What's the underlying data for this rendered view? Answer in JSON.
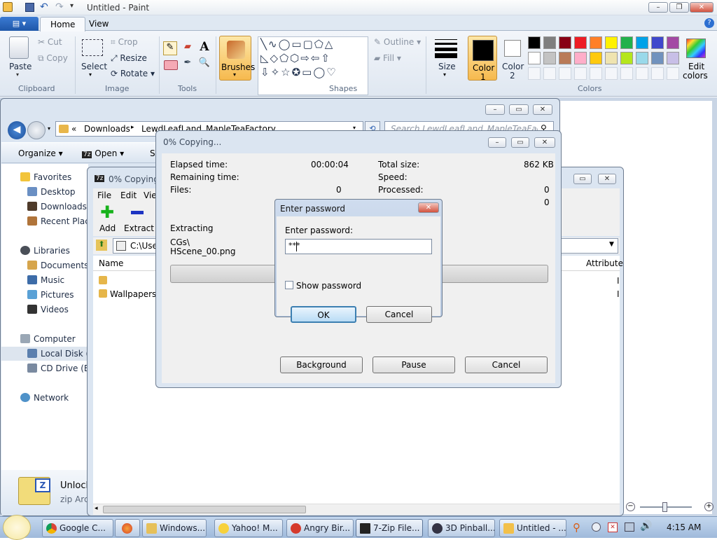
{
  "paint": {
    "title": "Untitled - Paint",
    "tabs": [
      "Home",
      "View"
    ],
    "groups": {
      "clipboard": "Clipboard",
      "image": "Image",
      "tools": "Tools",
      "shapes": "Shapes",
      "colors": "Colors"
    },
    "buttons": {
      "paste": "Paste",
      "cut": "Cut",
      "copy": "Copy",
      "select": "Select",
      "crop": "Crop",
      "resize": "Resize",
      "rotate": "Rotate",
      "brushes": "Brushes",
      "outline": "Outline",
      "fill": "Fill",
      "size": "Size",
      "color1": "Color\n1",
      "color1_a": "Color",
      "color1_b": "1",
      "color2_a": "Color",
      "color2_b": "2",
      "edit_colors_a": "Edit",
      "edit_colors_b": "colors"
    },
    "palette_row1": [
      "#000000",
      "#7f7f7f",
      "#880015",
      "#ed1c24",
      "#ff7f27",
      "#fff200",
      "#22b14c",
      "#00a2e8",
      "#3f48cc",
      "#a349a4"
    ],
    "palette_row2": [
      "#ffffff",
      "#c3c3c3",
      "#b97a57",
      "#ffaec9",
      "#ffc90e",
      "#efe4b0",
      "#b5e61d",
      "#99d9ea",
      "#7092be",
      "#c8bfe7"
    ]
  },
  "explorer": {
    "breadcrumb_root": "«",
    "breadcrumb_1": "Downloads",
    "breadcrumb_2": "LewdLeafLand_MapleTeaFactory",
    "search_placeholder": "Search LewdLeafLand_MapleTeaFacto",
    "organize": "Organize",
    "open": "Open",
    "share": "Sh",
    "nav": {
      "favorites": "Favorites",
      "desktop": "Desktop",
      "downloads": "Downloads",
      "recent": "Recent Place",
      "libraries": "Libraries",
      "documents": "Documents",
      "music": "Music",
      "pictures": "Pictures",
      "videos": "Videos",
      "computer": "Computer",
      "local_disk": "Local Disk (C",
      "cd_drive": "CD Drive (E:)",
      "network": "Network"
    },
    "preview_name": "Unlock",
    "preview_type": "zip Arch"
  },
  "sevenzip": {
    "title": "0% Copying...",
    "menu": [
      "File",
      "Edit",
      "Vie"
    ],
    "add": "Add",
    "extract": "Extract",
    "path": "C:\\Use",
    "col_name": "Name",
    "col_attr": "Attribute",
    "rows": [
      "",
      "Wallpapers"
    ],
    "attr_vals": [
      "I",
      "I"
    ]
  },
  "copying": {
    "title": "0% Copying...",
    "elapsed_label": "Elapsed time:",
    "elapsed_value": "00:00:04",
    "total_label": "Total size:",
    "total_value": "862 KB",
    "remaining_label": "Remaining time:",
    "speed_label": "Speed:",
    "files_label": "Files:",
    "files_value": "0",
    "processed_label": "Processed:",
    "processed_value": "0",
    "extra_value": "0",
    "extracting": "Extracting",
    "path_1": "CGs\\",
    "path_2": "HScene_00.png",
    "background": "Background",
    "pause": "Pause",
    "cancel": "Cancel"
  },
  "password": {
    "title": "Enter password",
    "label": "Enter password:",
    "value": "***",
    "show": "Show password",
    "ok": "OK",
    "cancel": "Cancel"
  },
  "taskbar": {
    "items": [
      "Google C...",
      "",
      "Windows...",
      "Yahoo! M...",
      "Angry Bir...",
      "7-Zip File...",
      "3D Pinball...",
      "Untitled - ..."
    ],
    "clock": "4:15 AM"
  }
}
